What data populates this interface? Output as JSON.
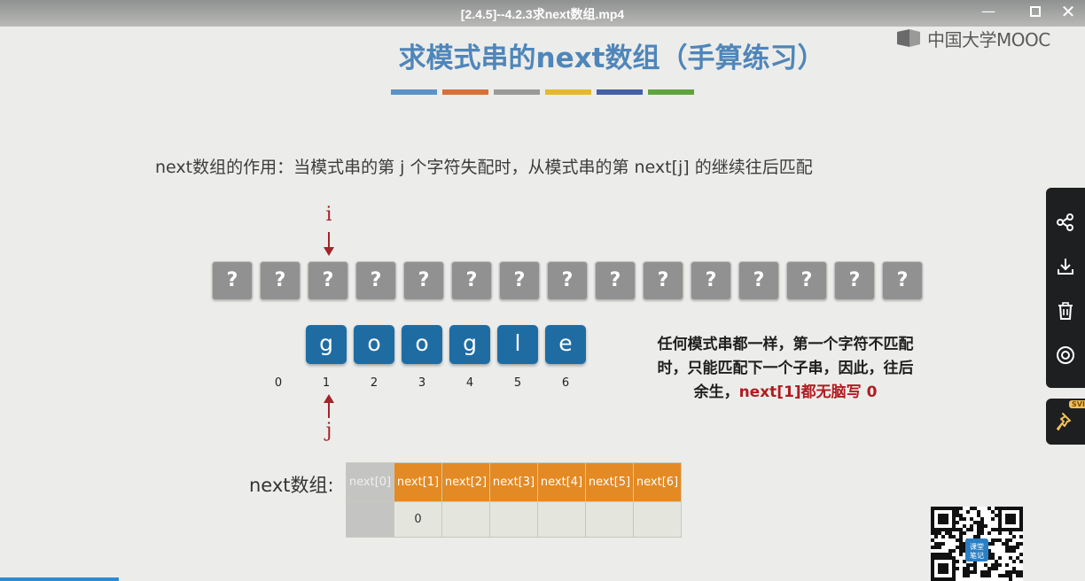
{
  "window": {
    "title": "[2.4.5]--4.2.3求next数组.mp4",
    "minimize_icon": "minimize-icon",
    "maximize_icon": "maximize-icon",
    "close_icon": "close-icon"
  },
  "brand": {
    "logo_text": "中国大学MOOC"
  },
  "slide": {
    "title": "求模式串的next数组（手算练习）",
    "title_color": "#4f86ba",
    "color_bar": [
      "#5b92c8",
      "#d9703a",
      "#9a9a98",
      "#e6b82c",
      "#4460a6",
      "#5fa43f"
    ],
    "description": "next数组的作用：当模式串的第 j 个字符失配时，从模式串的第 next[j] 的继续往后匹配",
    "pointer_i": "i",
    "pointer_j": "j",
    "main_string": [
      "?",
      "?",
      "?",
      "?",
      "?",
      "?",
      "?",
      "?",
      "?",
      "?",
      "?",
      "?",
      "?",
      "?",
      "?"
    ],
    "pattern": [
      "g",
      "o",
      "o",
      "g",
      "l",
      "e"
    ],
    "indices": [
      "0",
      "1",
      "2",
      "3",
      "4",
      "5",
      "6"
    ],
    "note_line1": "任何模式串都一样，第一个字符不匹配",
    "note_line2": "时，只能匹配下一个子串，因此，往后",
    "note_line3_prefix": "余生，",
    "note_line3_highlight": "next[1]都无脑写 0",
    "next_label": "next数组:",
    "next_headers": [
      "next[0]",
      "next[1]",
      "next[2]",
      "next[3]",
      "next[4]",
      "next[5]",
      "next[6]"
    ],
    "next_values": [
      "",
      "0",
      "",
      "",
      "",
      "",
      ""
    ],
    "header_color": "#e38a24",
    "pattern_color": "#1f6ca3",
    "unknown_color": "#909190"
  },
  "side_toolbar": {
    "buttons": [
      "share-icon",
      "download-icon",
      "delete-icon",
      "view-icon"
    ],
    "pin_icon": "pin-icon",
    "badge": "SVIP"
  },
  "qr": {
    "label_line1": "课堂",
    "label_line2": "笔记"
  }
}
